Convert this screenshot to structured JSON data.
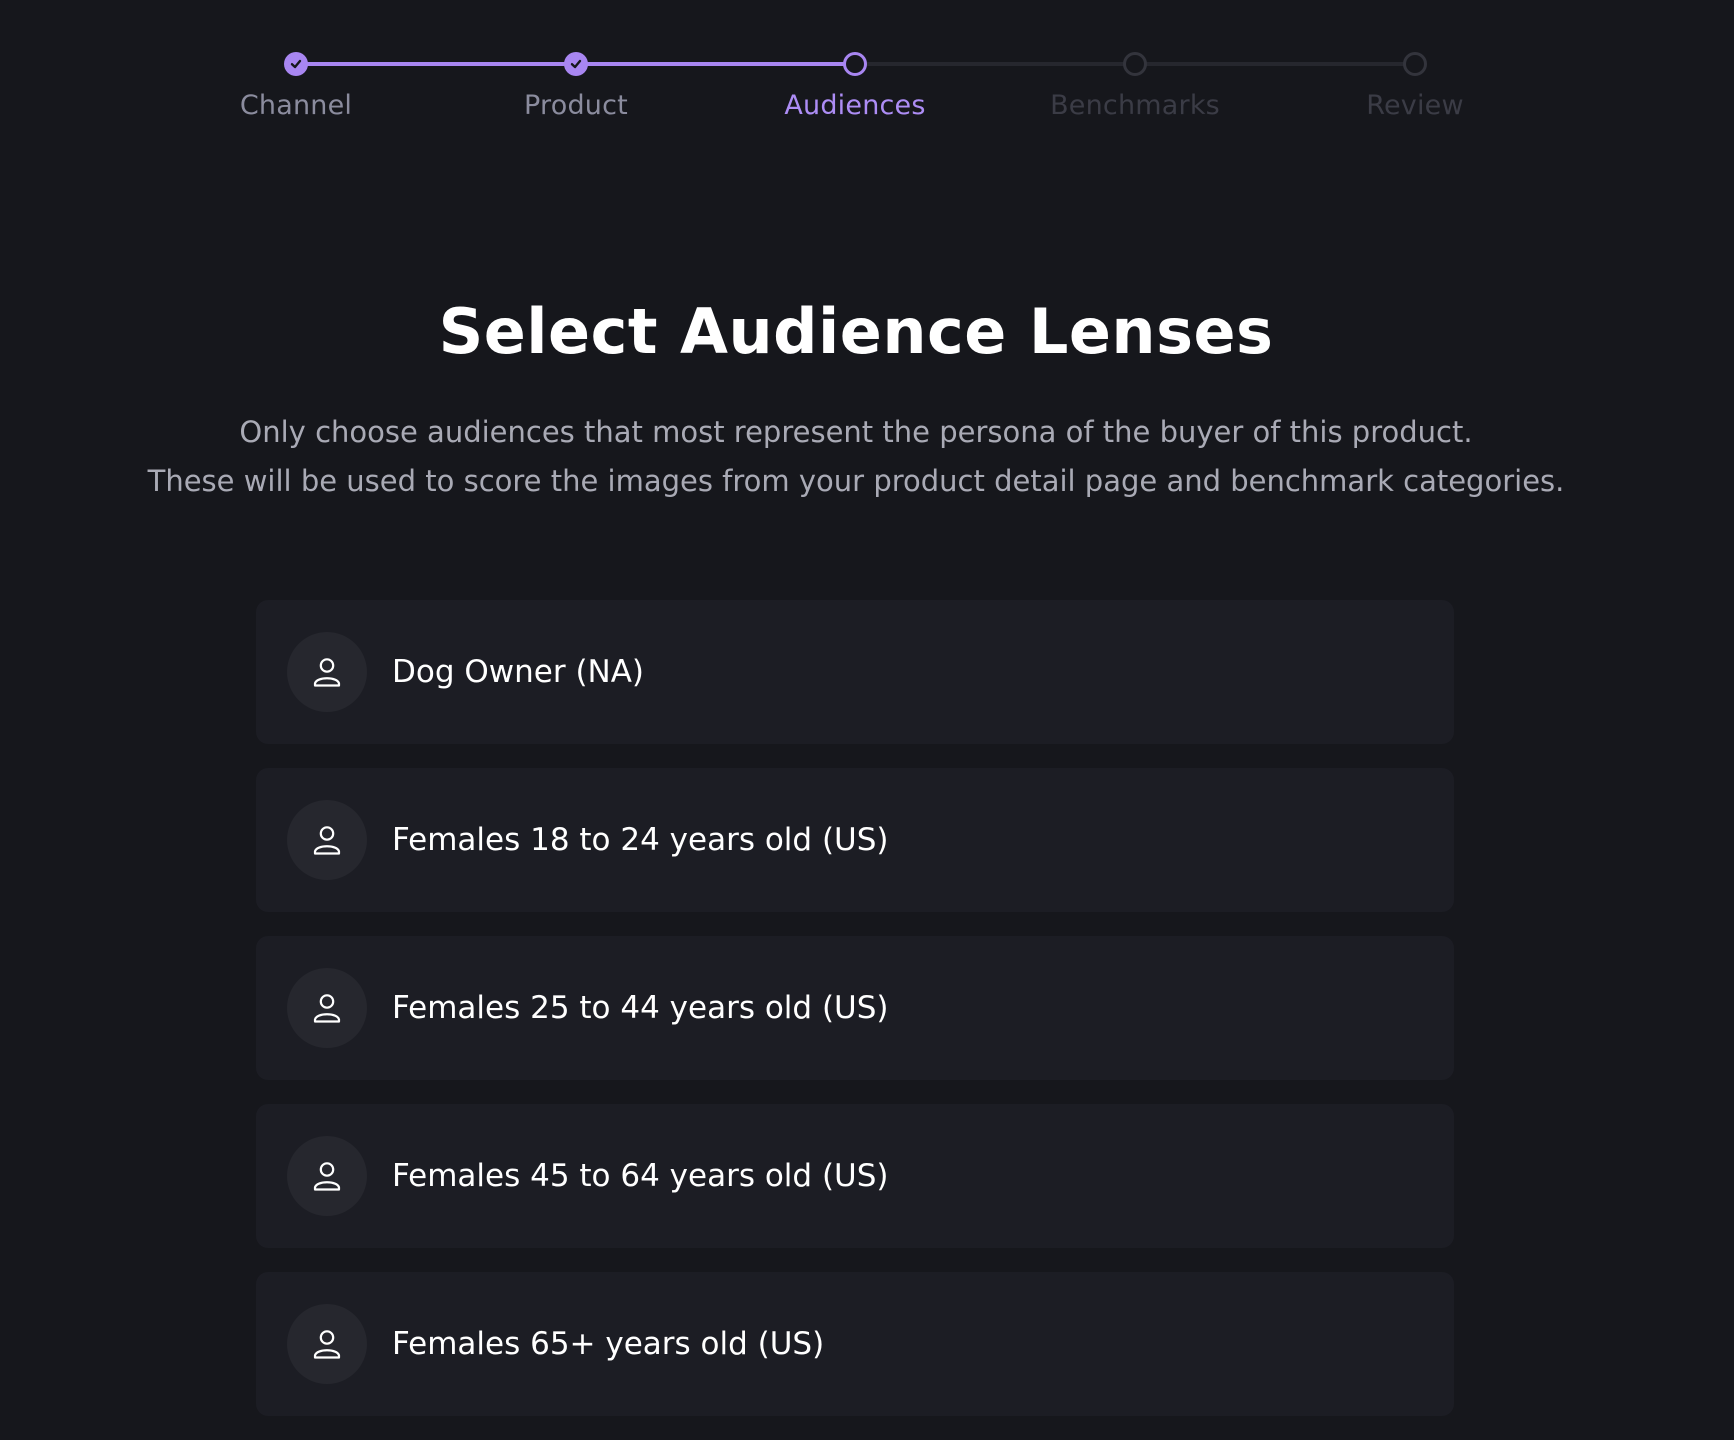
{
  "stepper": {
    "steps": [
      {
        "label": "Channel",
        "state": "completed"
      },
      {
        "label": "Product",
        "state": "completed"
      },
      {
        "label": "Audiences",
        "state": "current"
      },
      {
        "label": "Benchmarks",
        "state": "upcoming"
      },
      {
        "label": "Review",
        "state": "upcoming"
      }
    ],
    "colors": {
      "accent": "#a886f1",
      "completed_label": "#8b8c9e",
      "upcoming": "#33343c"
    }
  },
  "header": {
    "title": "Select Audience Lenses",
    "subtitle_line1": "Only choose audiences that most represent the persona of the buyer of this product.",
    "subtitle_line2": "These will be used to score the images from your product detail page and benchmark categories."
  },
  "audiences": {
    "icon": "user-icon",
    "items": [
      {
        "label": "Dog Owner (NA)"
      },
      {
        "label": "Females 18 to 24 years old (US)"
      },
      {
        "label": "Females 25 to 44 years old (US)"
      },
      {
        "label": "Females 45 to 64 years old (US)"
      },
      {
        "label": "Females 65+ years old (US)"
      }
    ]
  }
}
